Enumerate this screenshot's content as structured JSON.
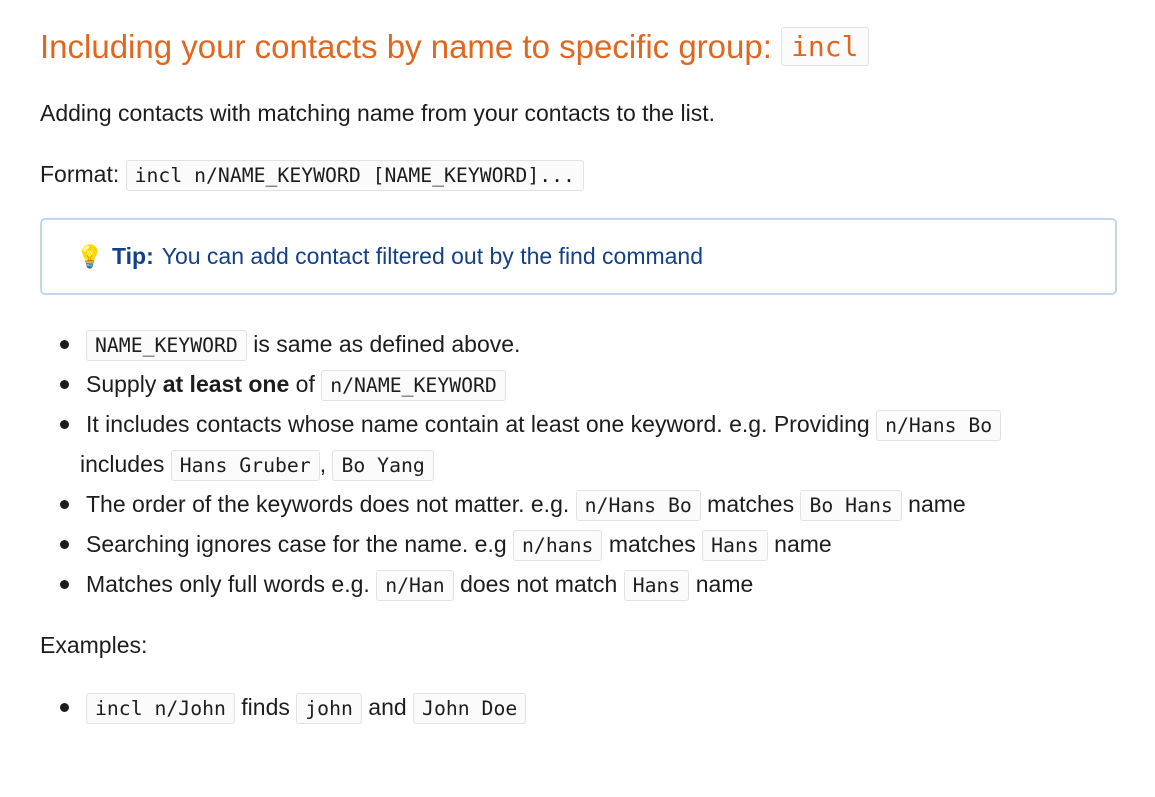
{
  "heading": {
    "text": "Including your contacts by name to specific group: ",
    "code": "incl"
  },
  "intro": "Adding contacts with matching name from your contacts to the list.",
  "format": {
    "label": "Format: ",
    "code": "incl n/NAME_KEYWORD [NAME_KEYWORD]..."
  },
  "tip": {
    "icon": "lightbulb-icon",
    "icon_glyph": "💡",
    "label": "Tip:",
    "text": "You can add contact filtered out by the find command"
  },
  "bullets": {
    "b1": {
      "code": "NAME_KEYWORD",
      "text": " is same as defined above."
    },
    "b2": {
      "pre": "Supply ",
      "bold": "at least one",
      "mid": " of ",
      "code": "n/NAME_KEYWORD"
    },
    "b3": {
      "pre": "It includes contacts whose name contain at least one keyword. e.g. Providing ",
      "code1": "n/Hans Bo",
      "mid": " includes ",
      "code2": "Hans Gruber",
      "sep": ", ",
      "code3": "Bo Yang"
    },
    "b4": {
      "pre": "The order of the keywords does not matter. e.g. ",
      "code1": "n/Hans Bo",
      "mid": " matches ",
      "code2": "Bo Hans",
      "post": " name"
    },
    "b5": {
      "pre": "Searching ignores case for the name. e.g ",
      "code1": "n/hans",
      "mid": " matches ",
      "code2": "Hans",
      "post": " name"
    },
    "b6": {
      "pre": "Matches only full words e.g. ",
      "code1": "n/Han",
      "mid": " does not match ",
      "code2": "Hans",
      "post": " name"
    }
  },
  "examples": {
    "label": "Examples:",
    "e1": {
      "code1": "incl n/John",
      "mid": " finds ",
      "code2": "john",
      "and": " and ",
      "code3": "John Doe"
    }
  }
}
